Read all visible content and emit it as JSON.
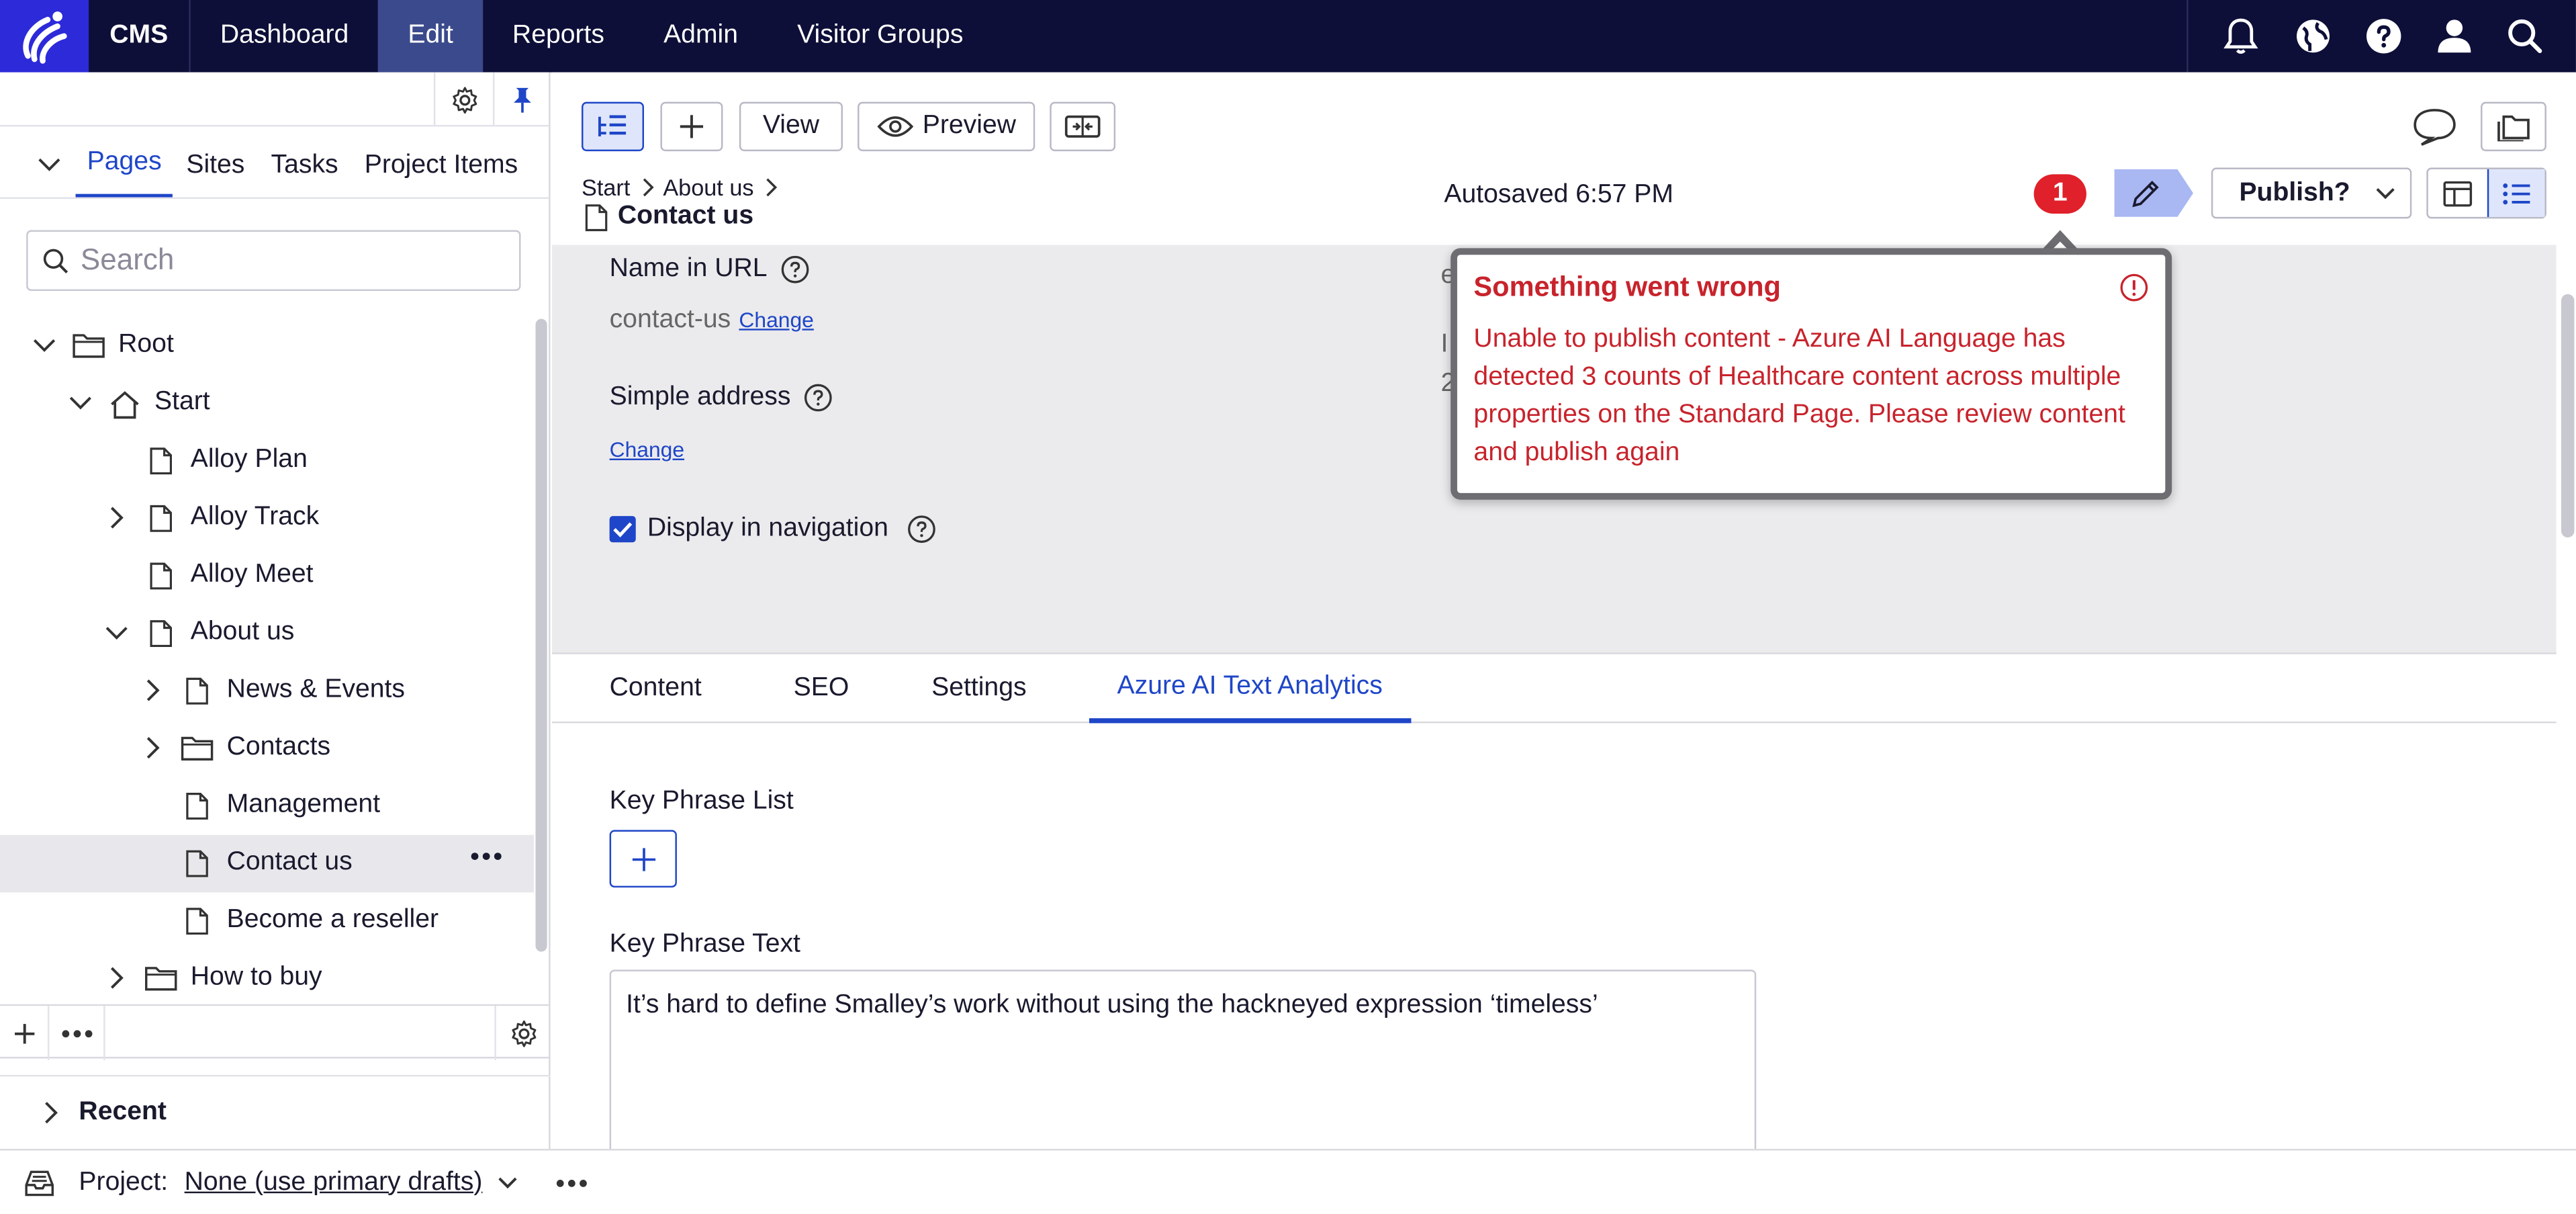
{
  "nav": {
    "brand": "CMS",
    "items": [
      {
        "label": "Dashboard",
        "active": false
      },
      {
        "label": "Edit",
        "active": true
      },
      {
        "label": "Reports",
        "active": false
      },
      {
        "label": "Admin",
        "active": false
      },
      {
        "label": "Visitor Groups",
        "active": false
      }
    ],
    "right_icons": [
      "bell-icon",
      "globe-icon",
      "help-icon",
      "user-icon",
      "search-icon"
    ]
  },
  "left_pane": {
    "tabs": [
      "Pages",
      "Sites",
      "Tasks",
      "Project Items"
    ],
    "active_tab": "Pages",
    "search_placeholder": "Search",
    "tree": [
      {
        "label": "Root",
        "depth": 0,
        "icon": "folder",
        "expand": "open"
      },
      {
        "label": "Start",
        "depth": 1,
        "icon": "home",
        "expand": "open"
      },
      {
        "label": "Alloy Plan",
        "depth": 2,
        "icon": "page",
        "expand": "none"
      },
      {
        "label": "Alloy Track",
        "depth": 2,
        "icon": "page",
        "expand": "closed"
      },
      {
        "label": "Alloy Meet",
        "depth": 2,
        "icon": "page",
        "expand": "none"
      },
      {
        "label": "About us",
        "depth": 2,
        "icon": "page",
        "expand": "open"
      },
      {
        "label": "News & Events",
        "depth": 3,
        "icon": "page",
        "expand": "closed"
      },
      {
        "label": "Contacts",
        "depth": 3,
        "icon": "folder",
        "expand": "closed"
      },
      {
        "label": "Management",
        "depth": 3,
        "icon": "page",
        "expand": "none"
      },
      {
        "label": "Contact us",
        "depth": 3,
        "icon": "page",
        "expand": "none",
        "selected": true
      },
      {
        "label": "Become a reseller",
        "depth": 3,
        "icon": "page",
        "expand": "none"
      },
      {
        "label": "How to buy",
        "depth": 2,
        "icon": "folder",
        "expand": "closed"
      }
    ],
    "recent_label": "Recent"
  },
  "footer": {
    "project_label": "Project:",
    "project_value": "None (use primary drafts)"
  },
  "toolbar": {
    "view_label": "View",
    "preview_label": "Preview"
  },
  "header": {
    "breadcrumbs": [
      "Start",
      "About us"
    ],
    "page_title": "Contact us",
    "autosaved": "Autosaved 6:57 PM",
    "notification_count": "1",
    "publish_label": "Publish?"
  },
  "props": {
    "name_in_url_label": "Name in URL",
    "name_in_url_value": "contact-us",
    "change_label": "Change",
    "simple_address_label": "Simple address",
    "display_in_nav_label": "Display in navigation",
    "display_in_nav_checked": true,
    "hidden_fragments": [
      "e",
      "I",
      "2"
    ]
  },
  "error_popover": {
    "title": "Something went wrong",
    "message": "Unable to publish content - Azure AI Language has detected 3 counts of Healthcare content across multiple properties on the Standard Page. Please review content and publish again"
  },
  "content_tabs": [
    {
      "label": "Content",
      "active": false
    },
    {
      "label": "SEO",
      "active": false
    },
    {
      "label": "Settings",
      "active": false
    },
    {
      "label": "Azure AI Text Analytics",
      "active": true
    }
  ],
  "form": {
    "key_phrase_list_label": "Key Phrase List",
    "key_phrase_text_label": "Key Phrase Text",
    "key_phrase_text_value": "It’s hard to define Smalley’s work without using the hackneyed expression ‘timeless’"
  },
  "colors": {
    "nav_bg": "#0d0f38",
    "accent": "#1f46c8",
    "error": "#c8232c",
    "badge": "#e0202a"
  }
}
